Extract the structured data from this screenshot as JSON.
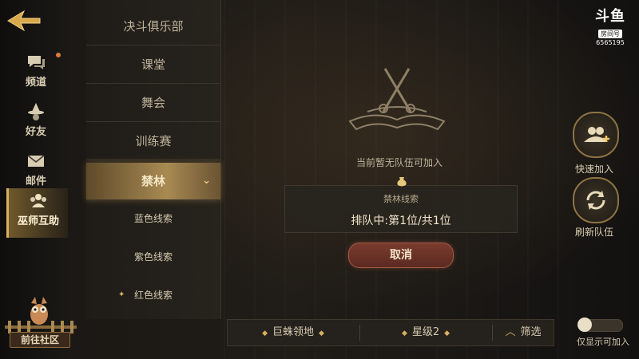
{
  "logo": {
    "brand": "斗鱼",
    "tag": "房间号",
    "room_number": "6565195"
  },
  "sidebar": {
    "items": [
      {
        "label": "频道",
        "icon": "chat-bubble-icon",
        "has_notification": true
      },
      {
        "label": "好友",
        "icon": "wizard-hat-icon",
        "has_notification": false
      },
      {
        "label": "邮件",
        "icon": "envelope-icon",
        "has_notification": false
      },
      {
        "label": "巫师互助",
        "icon": "group-icon",
        "has_notification": false,
        "active": true
      }
    ],
    "community_label": "前往社区"
  },
  "categories": {
    "items": [
      "决斗俱乐部",
      "课堂",
      "舞会",
      "训练赛"
    ],
    "selected": "禁林",
    "sub_items": [
      "蓝色线索",
      "紫色线索",
      "红色线索"
    ]
  },
  "queue": {
    "empty_text": "当前暂无队伍可加入",
    "title": "禁林线索",
    "status": "排队中:第1位/共1位",
    "cancel_label": "取消"
  },
  "filters": {
    "region": "巨蛛领地",
    "star": "星级2",
    "filter_label": "筛选"
  },
  "actions": {
    "quick_join": "快速加入",
    "refresh": "刷新队伍",
    "only_joinable_label": "仅显示可加入",
    "only_joinable_on": false
  },
  "colors": {
    "accent": "#d8b060",
    "cancel": "#6a3227",
    "background": "#1a1714"
  }
}
